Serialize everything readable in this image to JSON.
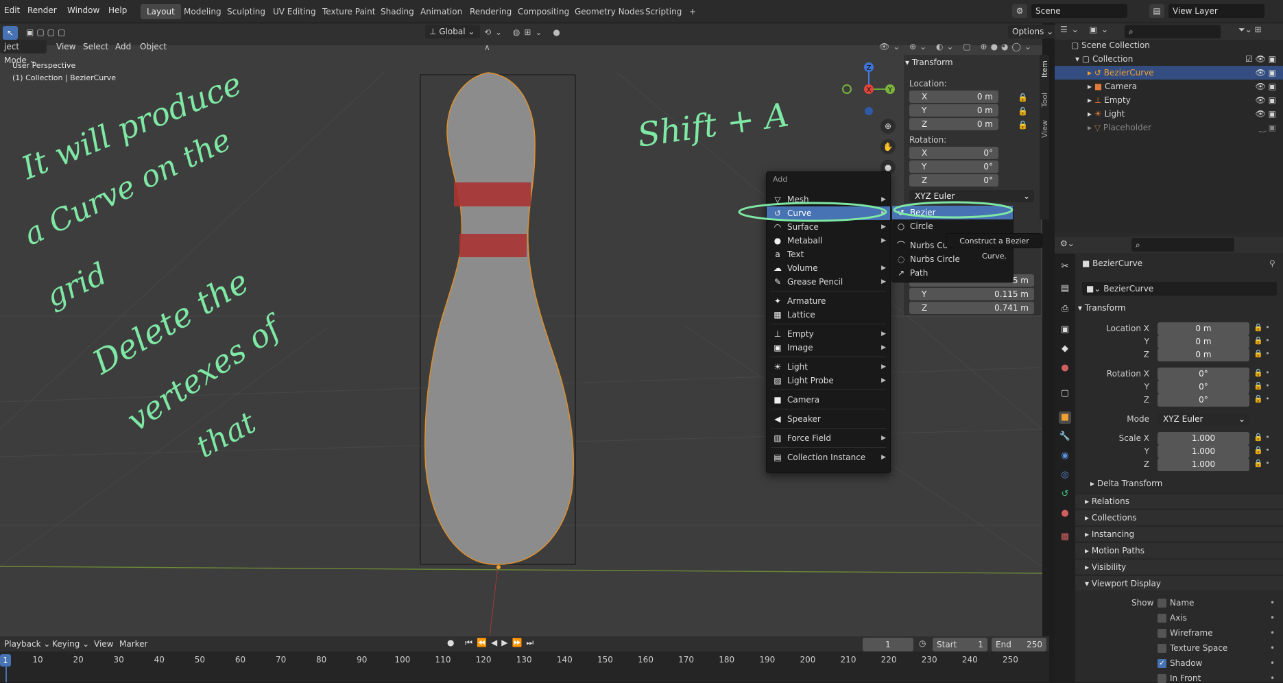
{
  "topbar": {
    "menus": [
      "Edit",
      "Render",
      "Window",
      "Help"
    ],
    "workspaces": [
      "Layout",
      "Modeling",
      "Sculpting",
      "UV Editing",
      "Texture Paint",
      "Shading",
      "Animation",
      "Rendering",
      "Compositing",
      "Geometry Nodes",
      "Scripting"
    ],
    "active_workspace": "Layout",
    "add_tab": "+",
    "scene": "Scene",
    "view_layer": "View Layer"
  },
  "viewport_header": {
    "mode": "ject Mode",
    "view": "View",
    "select": "Select",
    "add": "Add",
    "object": "Object",
    "orientation": "Global",
    "options": "Options"
  },
  "viewport": {
    "perspective": "User Perspective",
    "collection_info": "(1) Collection | BezierCurve"
  },
  "gizmo_axes": {
    "z": "Z",
    "y": "Y",
    "x": "X"
  },
  "sidebar_tabs": [
    "Item",
    "Tool",
    "View"
  ],
  "npanel": {
    "title": "Transform",
    "location_label": "Location:",
    "location": [
      {
        "axis": "X",
        "value": "0 m"
      },
      {
        "axis": "Y",
        "value": "0 m"
      },
      {
        "axis": "Z",
        "value": "0 m"
      }
    ],
    "rotation_label": "Rotation:",
    "rotation": [
      {
        "axis": "X",
        "value": "0°"
      },
      {
        "axis": "Y",
        "value": "0°"
      },
      {
        "axis": "Z",
        "value": "0°"
      }
    ],
    "rotation_mode": "XYZ Euler",
    "dims": [
      {
        "axis": "Y",
        "value": "0.115 m"
      },
      {
        "axis": "Z",
        "value": "0.741 m"
      }
    ],
    "dims_partial": "5 m"
  },
  "add_menu": {
    "title": "Add",
    "items": [
      {
        "label": "Mesh",
        "icon": "▽",
        "arrow": true
      },
      {
        "label": "Curve",
        "icon": "↺",
        "arrow": true,
        "highlight": true
      },
      {
        "label": "Surface",
        "icon": "◠",
        "arrow": true
      },
      {
        "label": "Metaball",
        "icon": "●",
        "arrow": true
      },
      {
        "label": "Text",
        "icon": "a",
        "arrow": false
      },
      {
        "label": "Volume",
        "icon": "☁",
        "arrow": true
      },
      {
        "label": "Grease Pencil",
        "icon": "✎",
        "arrow": true
      },
      {
        "label": "Armature",
        "icon": "✦",
        "arrow": false,
        "gap": true
      },
      {
        "label": "Lattice",
        "icon": "▦",
        "arrow": false
      },
      {
        "label": "Empty",
        "icon": "⊥",
        "arrow": true,
        "gap": true
      },
      {
        "label": "Image",
        "icon": "▣",
        "arrow": true
      },
      {
        "label": "Light",
        "icon": "☀",
        "arrow": true,
        "gap": true
      },
      {
        "label": "Light Probe",
        "icon": "▨",
        "arrow": true
      },
      {
        "label": "Camera",
        "icon": "■",
        "arrow": false,
        "gap": true
      },
      {
        "label": "Speaker",
        "icon": "◀",
        "arrow": false,
        "gap": true
      },
      {
        "label": "Force Field",
        "icon": "▥",
        "arrow": true,
        "gap": true
      },
      {
        "label": "Collection Instance",
        "icon": "▤",
        "arrow": true,
        "gap": true
      }
    ]
  },
  "curve_submenu": {
    "items": [
      {
        "label": "Bezier",
        "icon": "↺",
        "highlight": true
      },
      {
        "label": "Circle",
        "icon": "○"
      },
      {
        "label": "Nurbs Cur",
        "icon": "⌒"
      },
      {
        "label": "Nurbs Circle",
        "icon": "◌"
      },
      {
        "label": "Path",
        "icon": "↗"
      }
    ]
  },
  "tooltip": "Construct a Bezier Curve.",
  "handwriting": {
    "line1": "It will produce",
    "line2": "a Curve on the",
    "line3": "grid",
    "line4": "Delete the",
    "line5": "vertexes of",
    "line6": "that",
    "shortcut": "Shift + A"
  },
  "outliner": {
    "root": "Scene Collection",
    "collection": "Collection",
    "items": [
      {
        "name": "BezierCurve",
        "selected": true
      },
      {
        "name": "Camera"
      },
      {
        "name": "Empty"
      },
      {
        "name": "Light"
      },
      {
        "name": "Placeholder",
        "dim": true
      }
    ]
  },
  "properties": {
    "object_name": "BezierCurve",
    "datablock": "BezierCurve",
    "transform_title": "Transform",
    "location": [
      {
        "label": "Location X",
        "value": "0 m"
      },
      {
        "label": "Y",
        "value": "0 m"
      },
      {
        "label": "Z",
        "value": "0 m"
      }
    ],
    "rotation": [
      {
        "label": "Rotation X",
        "value": "0°"
      },
      {
        "label": "Y",
        "value": "0°"
      },
      {
        "label": "Z",
        "value": "0°"
      }
    ],
    "mode_label": "Mode",
    "mode_value": "XYZ Euler",
    "scale": [
      {
        "label": "Scale X",
        "value": "1.000"
      },
      {
        "label": "Y",
        "value": "1.000"
      },
      {
        "label": "Z",
        "value": "1.000"
      }
    ],
    "delta_transform": "Delta Transform",
    "sections": [
      "Relations",
      "Collections",
      "Instancing",
      "Motion Paths",
      "Visibility"
    ],
    "viewport_display": "Viewport Display",
    "show_label": "Show",
    "show_items": [
      {
        "label": "Name",
        "checked": false
      },
      {
        "label": "Axis",
        "checked": false
      },
      {
        "label": "Wireframe",
        "checked": false
      },
      {
        "label": "Texture Space",
        "checked": false
      },
      {
        "label": "Shadow",
        "checked": true
      },
      {
        "label": "In Front",
        "checked": false
      }
    ]
  },
  "timeline": {
    "playback": "Playback",
    "keying": "Keying",
    "view": "View",
    "marker": "Marker",
    "current_frame": "1",
    "start_label": "Start",
    "start_value": "1",
    "end_label": "End",
    "end_value": "250",
    "ticks": [
      "10",
      "20",
      "30",
      "40",
      "50",
      "60",
      "70",
      "80",
      "90",
      "100",
      "110",
      "120",
      "130",
      "140",
      "150",
      "160",
      "170",
      "180",
      "190",
      "200",
      "210",
      "220",
      "230",
      "240",
      "250"
    ],
    "current": "1"
  },
  "colors": {
    "accent": "#4772b3",
    "handwriting": "#7ee8a4",
    "selection_orange": "#f0a030"
  }
}
